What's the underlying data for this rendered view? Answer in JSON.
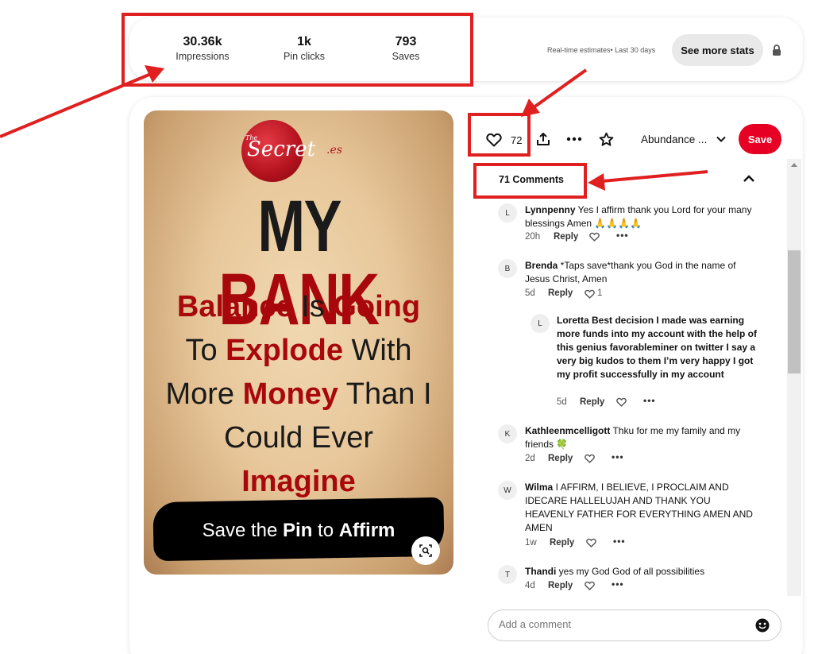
{
  "stats": {
    "impressions": {
      "value": "30.36k",
      "label": "Impressions"
    },
    "pin_clicks": {
      "value": "1k",
      "label": "Pin clicks"
    },
    "saves": {
      "value": "793",
      "label": "Saves"
    },
    "note": "Real-time estimates• Last 30 days",
    "see_more_label": "See more stats",
    "lock_icon": "lock-icon"
  },
  "pin": {
    "logo_the": "The",
    "logo_name": "Secret",
    "logo_suffix": ".es",
    "headline_dark": "MY",
    "headline_red": "BANK",
    "line1_red": "Balance",
    "line1_mid": " Is ",
    "line1_red2": "Going",
    "line2_a": "To ",
    "line2_red": "Explode",
    "line2_b": " With",
    "line3_a": "More ",
    "line3_red": "Money",
    "line3_b": " Than I",
    "line4": "Could Ever",
    "line5_red": "Imagine",
    "banner_a": "Save the ",
    "banner_b": "Pin",
    "banner_c": " to ",
    "banner_d": "Affirm"
  },
  "actions": {
    "like_count": "72",
    "board_name": "Abundance ...",
    "save_label": "Save"
  },
  "comments": {
    "header": "71 Comments",
    "items": [
      {
        "initial": "L",
        "author": "Lynnpenny",
        "text": " Yes I affirm thank you Lord for your many blessings Amen 🙏🙏🙏🙏",
        "time": "20h",
        "reply": "Reply",
        "likes": ""
      },
      {
        "initial": "B",
        "author": "Brenda",
        "text": " *Taps save*thank you God in the name of Jesus Christ, Amen",
        "time": "5d",
        "reply": "Reply",
        "likes": "1"
      },
      {
        "initial": "L",
        "author": "Loretta",
        "text": " Best decision I made was earning more funds into my account with the help of this genius favorableminer on twitter I say a very big kudos to them I’m very happy I got my profit successfully in my account",
        "time": "5d",
        "reply": "Reply",
        "likes": ""
      },
      {
        "initial": "K",
        "author": "Kathleenmcelligott",
        "text": " Thku for me my family and my friends 🍀",
        "time": "2d",
        "reply": "Reply",
        "likes": ""
      },
      {
        "initial": "W",
        "author": "Wilma",
        "text": " I AFFIRM, I BELIEVE, I PROCLAIM AND IDECARE HALLELUJAH AND THANK YOU HEAVENLY FATHER FOR EVERYTHING AMEN AND AMEN",
        "time": "1w",
        "reply": "Reply",
        "likes": ""
      },
      {
        "initial": "T",
        "author": "Thandi",
        "text": " yes my God God of all possibilities",
        "time": "4d",
        "reply": "Reply",
        "likes": ""
      }
    ],
    "input_placeholder": "Add a comment"
  },
  "colors": {
    "accent": "#e60023",
    "annotation": "#e02020"
  }
}
